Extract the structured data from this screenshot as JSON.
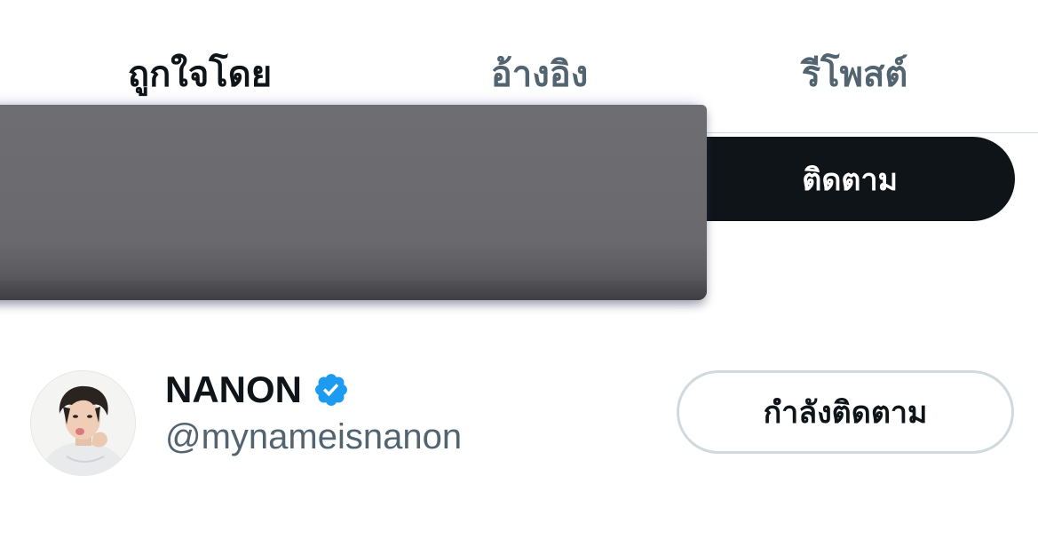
{
  "tabs": [
    {
      "label": "ถูกใจโดย",
      "active": true
    },
    {
      "label": "อ้างอิง",
      "active": false
    },
    {
      "label": "รีโพสต์",
      "active": false
    }
  ],
  "follow_button": {
    "label": "ติดตาม"
  },
  "user": {
    "display_name": "NANON",
    "handle": "@mynameisnanon",
    "verified": true,
    "follow_state_label": "กำลังติดตาม"
  },
  "colors": {
    "text_primary": "#0f1419",
    "text_secondary": "#536471",
    "verified_blue": "#1d9bf0",
    "border": "#cfd9de"
  },
  "icons": {
    "verified": "verified-badge-icon",
    "avatar": "profile-photo"
  }
}
